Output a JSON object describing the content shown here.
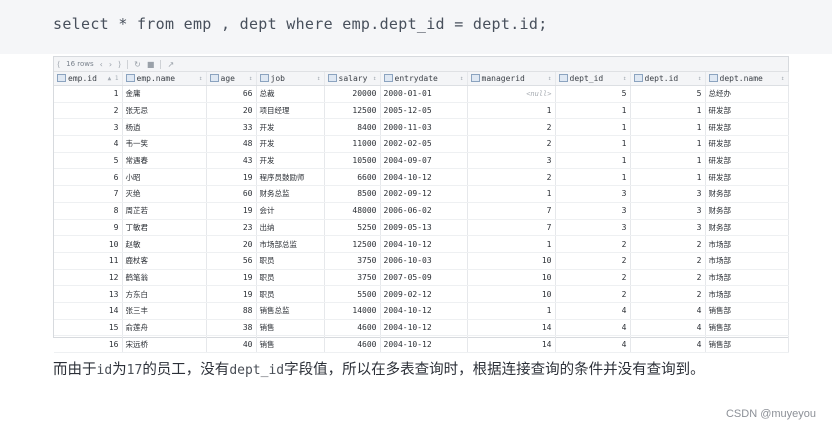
{
  "sql": "select * from emp , dept where emp.dept_id = dept.id;",
  "toolbar": {
    "rows_label": "16 rows",
    "first": "⟨",
    "prev": "‹",
    "next": "›",
    "last": "⟩",
    "refresh": "↻",
    "stop": "■",
    "pin": "↗"
  },
  "columns": [
    "emp.id",
    "emp.name",
    "age",
    "job",
    "salary",
    "entrydate",
    "managerid",
    "dept_id",
    "dept.id",
    "dept.name"
  ],
  "first_sort_marker": "▲ 1",
  "null_text": "<null>",
  "rows": [
    [
      "1",
      "金庸",
      "66",
      "总裁",
      "20000",
      "2000-01-01",
      "<null>",
      "5",
      "5",
      "总经办"
    ],
    [
      "2",
      "张无忌",
      "20",
      "项目经理",
      "12500",
      "2005-12-05",
      "1",
      "1",
      "1",
      "研发部"
    ],
    [
      "3",
      "杨逍",
      "33",
      "开发",
      "8400",
      "2000-11-03",
      "2",
      "1",
      "1",
      "研发部"
    ],
    [
      "4",
      "韦一笑",
      "48",
      "开发",
      "11000",
      "2002-02-05",
      "2",
      "1",
      "1",
      "研发部"
    ],
    [
      "5",
      "常遇春",
      "43",
      "开发",
      "10500",
      "2004-09-07",
      "3",
      "1",
      "1",
      "研发部"
    ],
    [
      "6",
      "小昭",
      "19",
      "程序员鼓励师",
      "6600",
      "2004-10-12",
      "2",
      "1",
      "1",
      "研发部"
    ],
    [
      "7",
      "灭绝",
      "60",
      "财务总监",
      "8500",
      "2002-09-12",
      "1",
      "3",
      "3",
      "财务部"
    ],
    [
      "8",
      "周芷若",
      "19",
      "会计",
      "48000",
      "2006-06-02",
      "7",
      "3",
      "3",
      "财务部"
    ],
    [
      "9",
      "丁敏君",
      "23",
      "出纳",
      "5250",
      "2009-05-13",
      "7",
      "3",
      "3",
      "财务部"
    ],
    [
      "10",
      "赵敏",
      "20",
      "市场部总监",
      "12500",
      "2004-10-12",
      "1",
      "2",
      "2",
      "市场部"
    ],
    [
      "11",
      "鹿杖客",
      "56",
      "职员",
      "3750",
      "2006-10-03",
      "10",
      "2",
      "2",
      "市场部"
    ],
    [
      "12",
      "鹤笔翁",
      "19",
      "职员",
      "3750",
      "2007-05-09",
      "10",
      "2",
      "2",
      "市场部"
    ],
    [
      "13",
      "方东白",
      "19",
      "职员",
      "5500",
      "2009-02-12",
      "10",
      "2",
      "2",
      "市场部"
    ],
    [
      "14",
      "张三丰",
      "88",
      "销售总监",
      "14000",
      "2004-10-12",
      "1",
      "4",
      "4",
      "销售部"
    ],
    [
      "15",
      "俞莲舟",
      "38",
      "销售",
      "4600",
      "2004-10-12",
      "14",
      "4",
      "4",
      "销售部"
    ],
    [
      "16",
      "宋远桥",
      "40",
      "销售",
      "4600",
      "2004-10-12",
      "14",
      "4",
      "4",
      "销售部"
    ]
  ],
  "paragraph": {
    "p1": "而由于",
    "c1": "id",
    "p2": "为",
    "c2": "17",
    "p3": "的员工，没有",
    "c3": "dept_id",
    "p4": "字段值，所以在多表查询时，根据连接查询的条件并没有查询到。"
  },
  "watermark": "CSDN @muyeyou"
}
